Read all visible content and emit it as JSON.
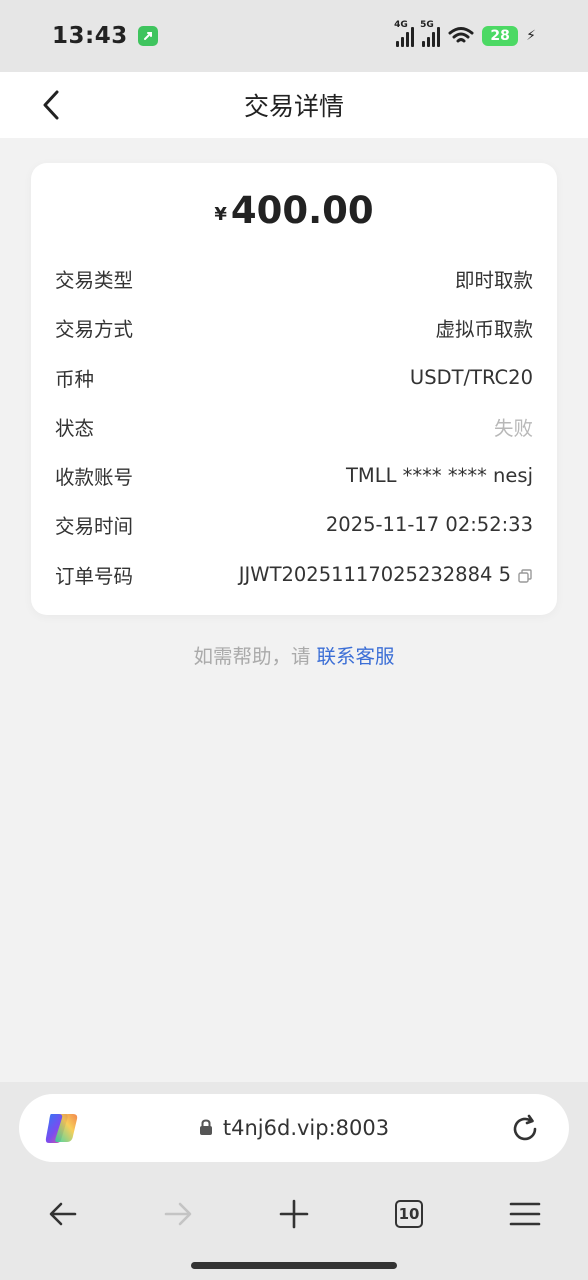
{
  "status_bar": {
    "time": "13:43",
    "net1": "4G",
    "net2": "5G",
    "battery": "28",
    "icons": [
      "app-badge-icon",
      "signal-icon",
      "wifi-icon",
      "battery-icon",
      "charging-icon"
    ]
  },
  "header": {
    "title": "交易详情",
    "back_icon": "chevron-left-icon"
  },
  "detail": {
    "currency_symbol": "¥",
    "amount": "400.00",
    "rows": [
      {
        "label": "交易类型",
        "value": "即时取款"
      },
      {
        "label": "交易方式",
        "value": "虚拟币取款"
      },
      {
        "label": "币种",
        "value": "USDT/TRC20"
      },
      {
        "label": "状态",
        "value": "失败"
      },
      {
        "label": "收款账号",
        "value": "TMLL **** **** nesj"
      },
      {
        "label": "交易时间",
        "value": "2025-11-17 02:52:33"
      },
      {
        "label": "订单号码",
        "value": "JJWT20251117025232884 5"
      }
    ],
    "status_color": "#b8b8b8"
  },
  "help": {
    "text": "如需帮助，请",
    "link": "联系客服",
    "link_color": "#3c6fd6"
  },
  "browser": {
    "url": "t4nj6d.vip:8003",
    "tab_count": "10",
    "icons": [
      "copilot-icon",
      "lock-icon",
      "reload-icon",
      "back-arrow-icon",
      "forward-arrow-icon",
      "plus-icon",
      "tabs-icon",
      "menu-icon"
    ]
  }
}
